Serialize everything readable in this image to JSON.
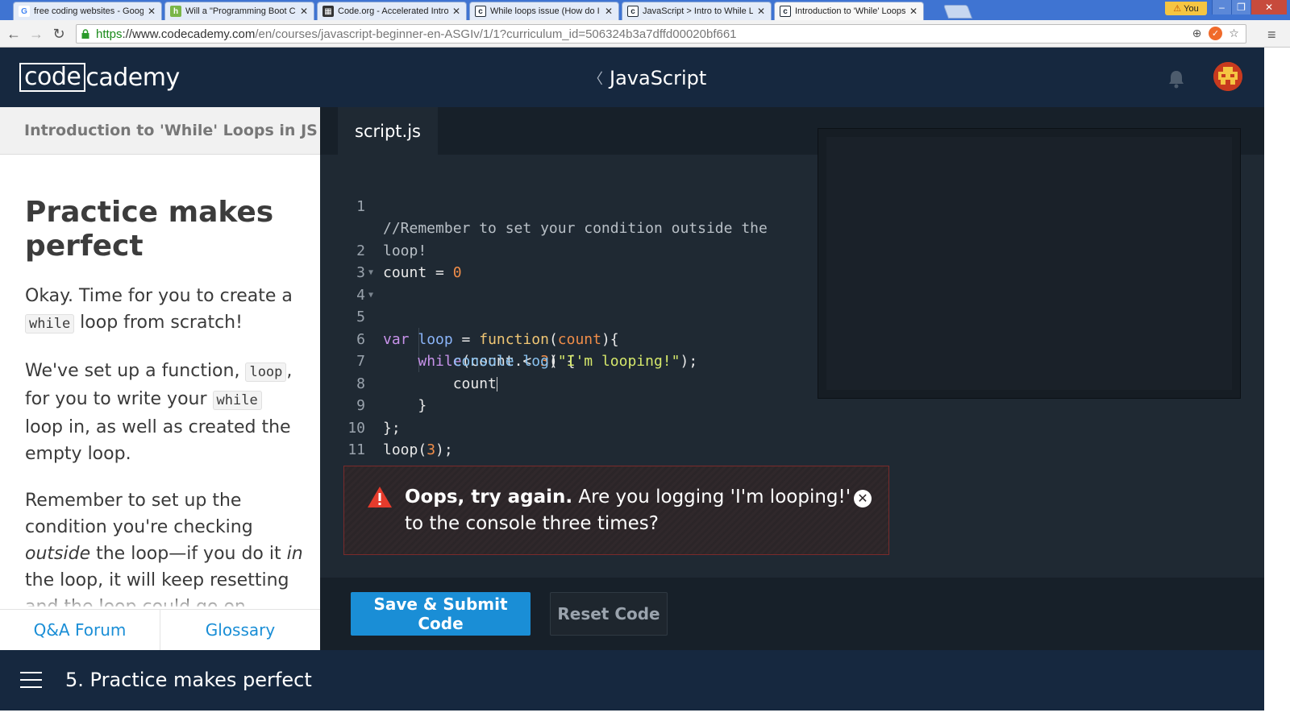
{
  "browser": {
    "tabs": [
      {
        "title": "free coding websites - Googl",
        "favicon": "G",
        "color": "#4285f4"
      },
      {
        "title": "Will a \"Programming Boot Ca",
        "favicon": "h",
        "color": "#7ab648"
      },
      {
        "title": "Code.org - Accelerated Intro",
        "favicon": "::",
        "color": "#333333"
      },
      {
        "title": "While loops issue (How do I",
        "favicon": "c",
        "color": "#1f2a36"
      },
      {
        "title": "JavaScript > Intro to While L",
        "favicon": "c",
        "color": "#1f2a36"
      },
      {
        "title": "Introduction to 'While' Loops",
        "favicon": "c",
        "color": "#1f2a36"
      }
    ],
    "user_label": "You",
    "url_https": "https",
    "url_host": "://www.codecademy.com",
    "url_path": "/en/courses/javascript-beginner-en-ASGIv/1/1?curriculum_id=506324b3a7dffd00020bf661"
  },
  "header": {
    "logo_boxed": "code",
    "logo_rest": "cademy",
    "course": "JavaScript"
  },
  "lesson": {
    "unit_title": "Introduction to 'While' Loops in JS",
    "title": "Practice makes perfect",
    "p1_a": "Okay. Time for you to create a ",
    "p1_code": "while",
    "p1_b": " loop from scratch!",
    "p2_a": "We've set up a function, ",
    "p2_code1": "loop",
    "p2_b": ", for you to write your ",
    "p2_code2": "while",
    "p2_c": " loop in, as well as created the empty loop.",
    "p3_a": "Remember to set up the condition you're checking ",
    "p3_em1": "outside",
    "p3_b": " the loop—if you do it ",
    "p3_em2": "in",
    "p3_c": " the loop, it will keep resetting and the loop could go on forever!",
    "footer_qa": "Q&A Forum",
    "footer_glossary": "Glossary"
  },
  "editor": {
    "file_tab": "script.js",
    "line_numbers": [
      "1",
      "2",
      "3",
      "4",
      "5",
      "6",
      "7",
      "8",
      "9",
      "10",
      "11"
    ],
    "code": {
      "l1": "//Remember to set your condition outside the loop!",
      "l2_var": "count",
      "l2_op": " = ",
      "l2_num": "0",
      "l4_kw": "var",
      "l4_name": "loop",
      "l4_op": " = ",
      "l4_fn": "function",
      "l4_open": "(",
      "l4_param": "count",
      "l4_close": "){",
      "l5_kw": "while",
      "l5_open": "(",
      "l5_var": "count",
      "l5_op": " < ",
      "l5_num": "3",
      "l5_close": ") {",
      "l6_obj": "console",
      "l6_dot": ".",
      "l6_method": "log",
      "l6_open": "(",
      "l6_str": "\"I'm looping!\"",
      "l6_close": ");",
      "l7": "count",
      "l8": "}",
      "l9": "};",
      "l10_fn": "loop",
      "l10_open": "(",
      "l10_num": "3",
      "l10_close": ");"
    },
    "error_bold": "Oops, try again.",
    "error_msg": " Are you logging 'I'm looping!' to the console three times?",
    "submit_label": "Save & Submit Code",
    "reset_label": "Reset Code"
  },
  "footer": {
    "exercise_title": "5. Practice makes perfect"
  }
}
